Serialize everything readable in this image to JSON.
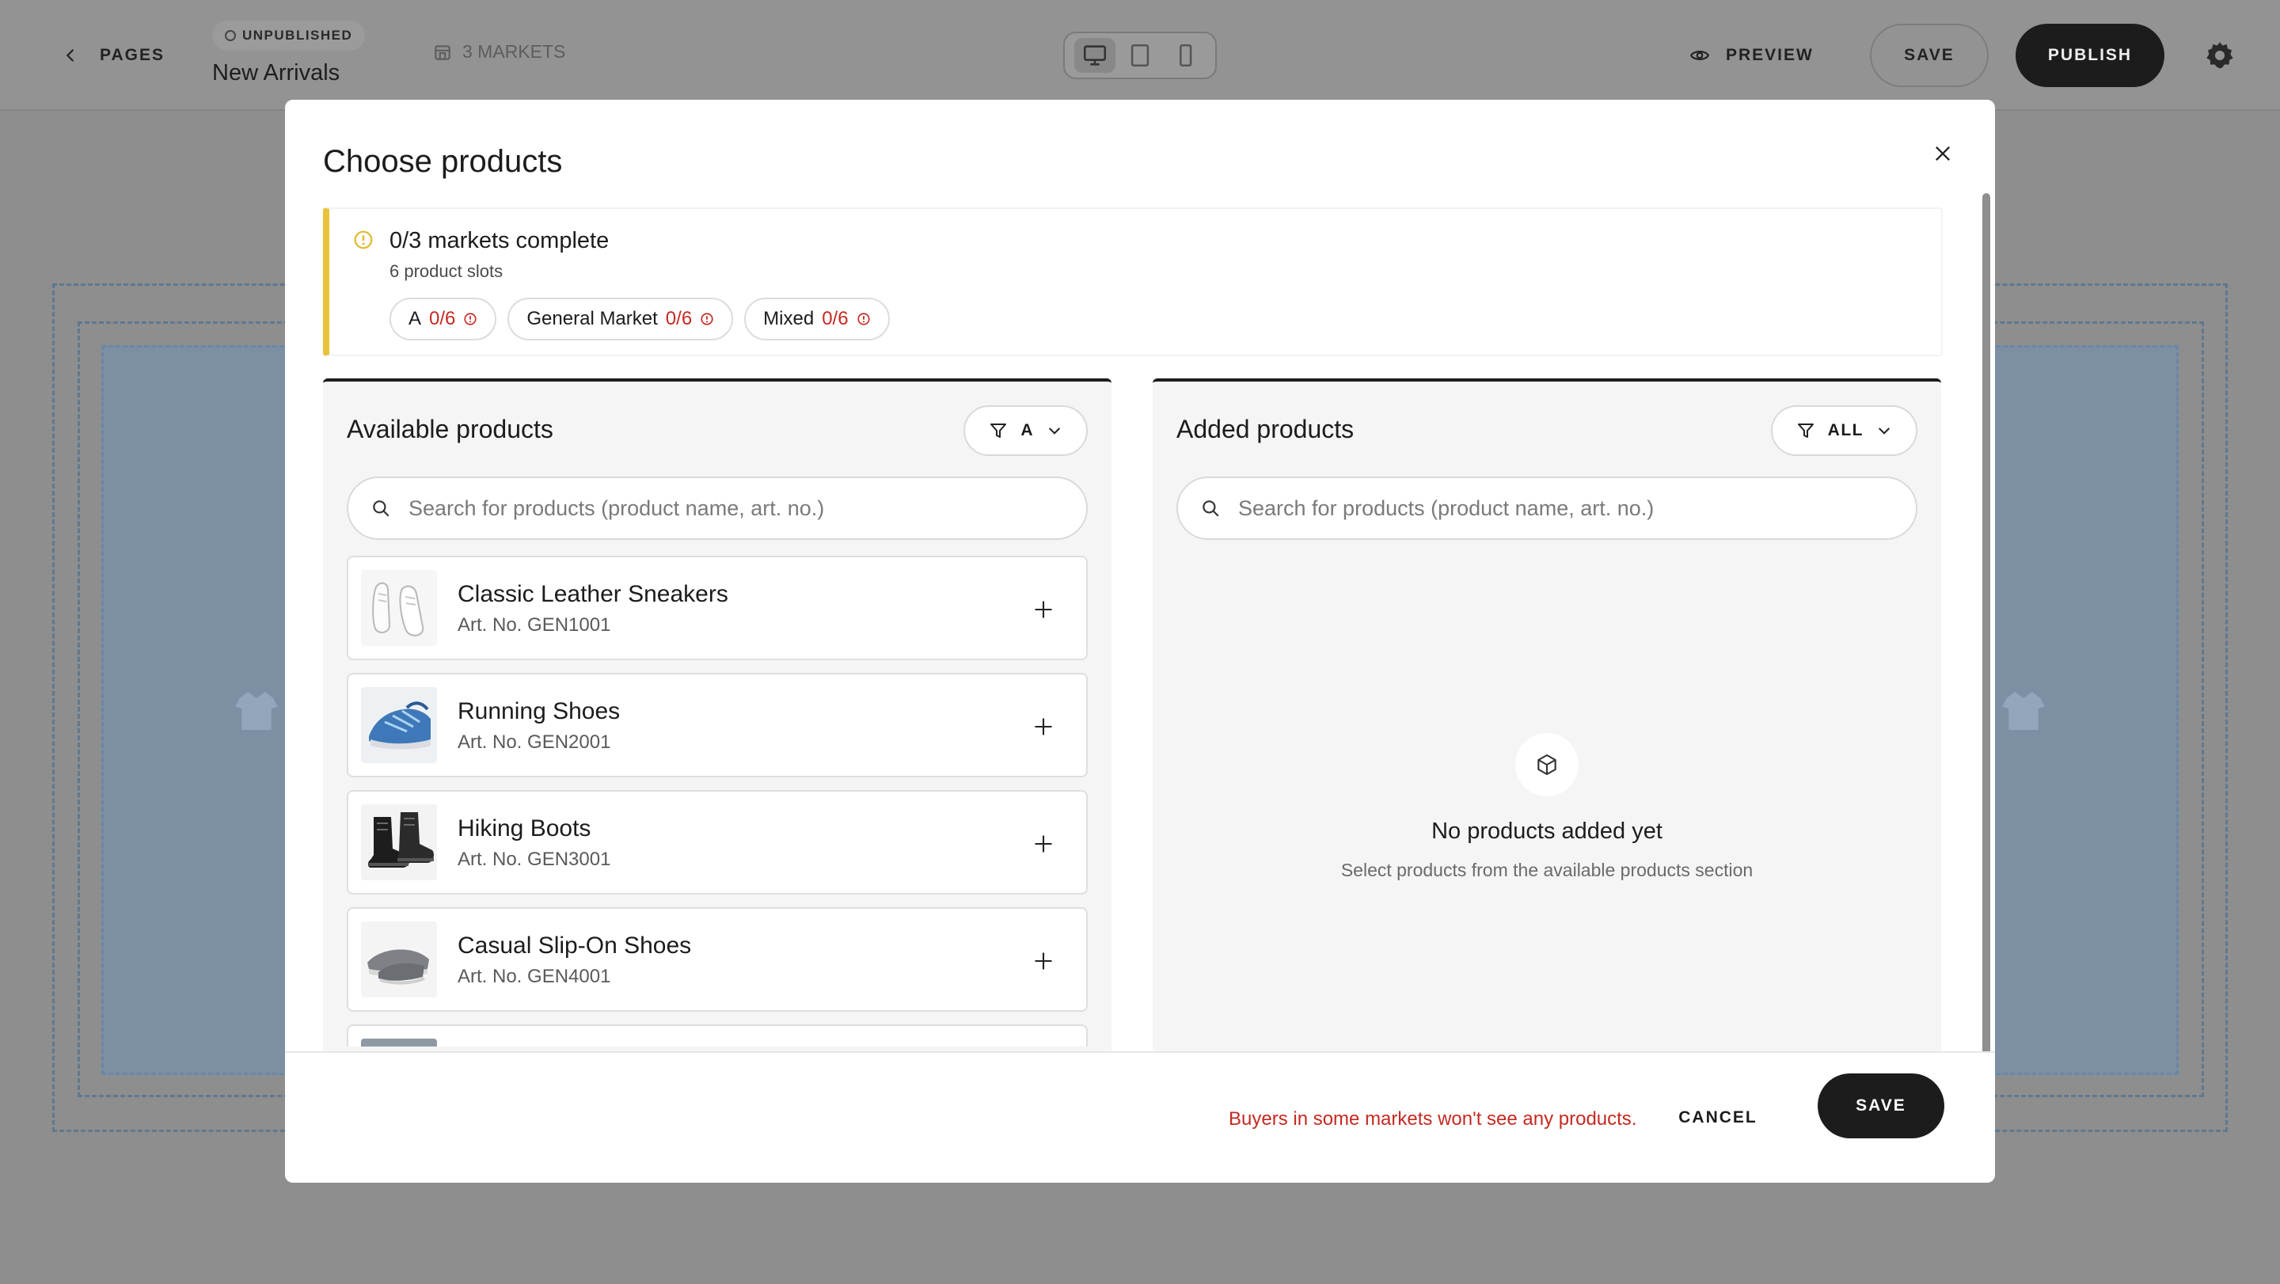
{
  "topbar": {
    "back_label": "PAGES",
    "status_label": "UNPUBLISHED",
    "page_title": "New Arrivals",
    "markets_label": "3 MARKETS",
    "preview_label": "PREVIEW",
    "save_label": "SAVE",
    "publish_label": "PUBLISH",
    "active_device": "desktop"
  },
  "modal": {
    "title": "Choose products",
    "warning": {
      "title": "0/3 markets complete",
      "subtitle": "6 product slots",
      "accent_color": "#e8c33a",
      "markets": [
        {
          "name": "A",
          "count": "0/6"
        },
        {
          "name": "General Market",
          "count": "0/6"
        },
        {
          "name": "Mixed",
          "count": "0/6"
        }
      ]
    },
    "available": {
      "title": "Available products",
      "filter_value": "A",
      "search_placeholder": "Search for products (product name, art. no.)",
      "products": [
        {
          "name": "Classic Leather Sneakers",
          "art": "Art. No. GEN1001",
          "thumb_icon": "white-sneaker-icon"
        },
        {
          "name": "Running Shoes",
          "art": "Art. No. GEN2001",
          "thumb_icon": "blue-running-shoe-icon"
        },
        {
          "name": "Hiking Boots",
          "art": "Art. No. GEN3001",
          "thumb_icon": "black-boot-icon"
        },
        {
          "name": "Casual Slip-On Shoes",
          "art": "Art. No. GEN4001",
          "thumb_icon": "grey-slip-on-icon"
        }
      ]
    },
    "added": {
      "title": "Added products",
      "filter_value": "ALL",
      "search_placeholder": "Search for products (product name, art. no.)",
      "empty_title": "No products added yet",
      "empty_subtitle": "Select products from the available products section"
    },
    "footer": {
      "warning_text": "Buyers in some markets won't see any products.",
      "warning_color": "#c42a22",
      "cancel_label": "CANCEL",
      "save_label": "SAVE"
    }
  }
}
